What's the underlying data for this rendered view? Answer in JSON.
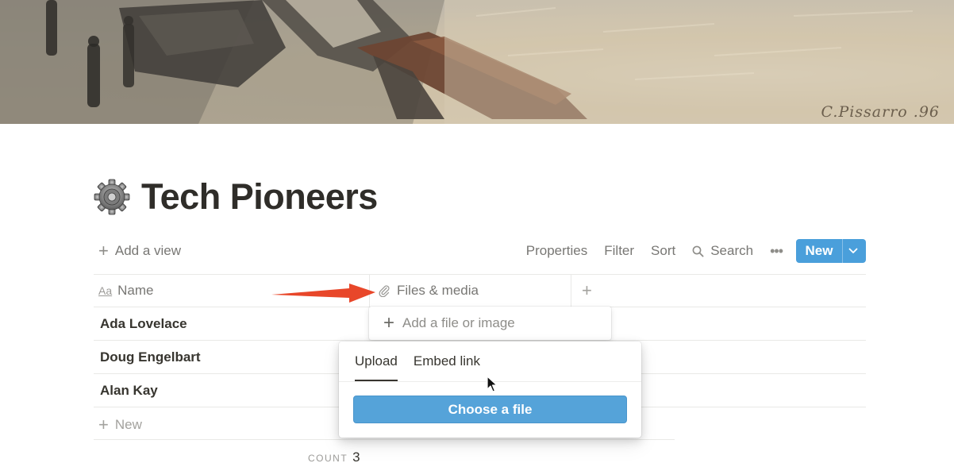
{
  "cover": {
    "signature": "C.Pissarro .96"
  },
  "page": {
    "title": "Tech Pioneers"
  },
  "toolbar": {
    "add_view": "Add a view",
    "properties": "Properties",
    "filter": "Filter",
    "sort": "Sort",
    "search": "Search",
    "new": "New"
  },
  "table": {
    "columns": [
      {
        "label": "Name",
        "icon": "text-property-icon"
      },
      {
        "label": "Files & media",
        "icon": "paperclip-icon"
      }
    ],
    "rows": [
      {
        "name": "Ada Lovelace"
      },
      {
        "name": "Doug Engelbart"
      },
      {
        "name": "Alan Kay"
      }
    ],
    "add_row": "New",
    "count_label": "COUNT",
    "count_value": "3"
  },
  "file_popup": {
    "add_label": "Add a file or image",
    "tabs": [
      "Upload",
      "Embed link"
    ],
    "active_tab": "Upload",
    "choose_button": "Choose a file"
  },
  "colors": {
    "accent": "#4a9fdb",
    "button": "#55a3d9",
    "arrow": "#e8472a",
    "text": "#37352f",
    "muted": "#787774"
  }
}
